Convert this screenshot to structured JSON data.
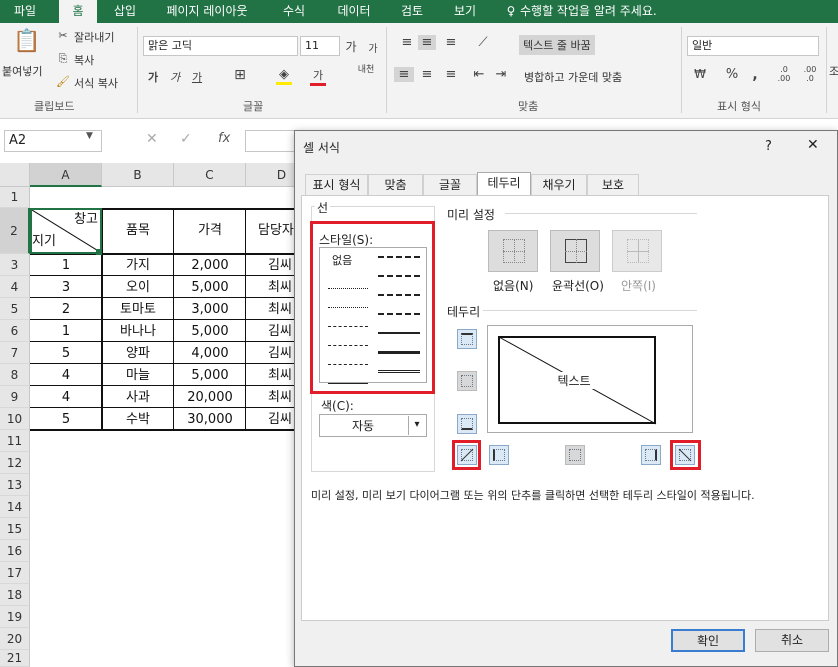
{
  "menubar": {
    "tabs": [
      "파일",
      "홈",
      "삽입",
      "페이지 레이아웃",
      "수식",
      "데이터",
      "검토",
      "보기"
    ],
    "tell_me": "수행할 작업을 알려 주세요."
  },
  "ribbon": {
    "clipboard": {
      "paste": "붙여넣기",
      "cut": "잘라내기",
      "copy": "복사",
      "format_painter": "서식 복사",
      "group": "클립보드"
    },
    "font": {
      "font_name": "맑은 고딕",
      "font_size": "11",
      "group": "글꼴",
      "grow": "가",
      "shrink": "가",
      "bold": "가",
      "italic": "가",
      "underline": "가",
      "font_color": "가",
      "phonetic": "내천"
    },
    "alignment": {
      "wrap": "텍스트 줄 바꿈",
      "merge": "병합하고 가운데 맞춤",
      "group": "맞춤"
    },
    "number": {
      "format": "일반",
      "group": "표시 형식",
      "percent": "%",
      "comma": ","
    },
    "extra": "조"
  },
  "formula_bar": {
    "name_box": "A2",
    "fx": "fx"
  },
  "sheet": {
    "columns": [
      "A",
      "B",
      "C",
      "D"
    ],
    "rows": [
      "1",
      "2",
      "3",
      "4",
      "5",
      "6",
      "7",
      "8",
      "9",
      "10",
      "11",
      "12",
      "13",
      "14",
      "15",
      "16",
      "17",
      "18",
      "19",
      "20",
      "21"
    ],
    "header": {
      "diag_top": "창고",
      "diag_bottom": "지기",
      "b": "품목",
      "c": "가격",
      "d": "담당자"
    },
    "data": [
      [
        "1",
        "가지",
        "2,000",
        "김씨"
      ],
      [
        "3",
        "오이",
        "5,000",
        "최씨"
      ],
      [
        "2",
        "토마토",
        "3,000",
        "최씨"
      ],
      [
        "1",
        "바나나",
        "5,000",
        "김씨"
      ],
      [
        "5",
        "양파",
        "4,000",
        "김씨"
      ],
      [
        "4",
        "마늘",
        "5,000",
        "최씨"
      ],
      [
        "4",
        "사과",
        "20,000",
        "최씨"
      ],
      [
        "5",
        "수박",
        "30,000",
        "김씨"
      ]
    ]
  },
  "dialog": {
    "title": "셀 서식",
    "help": "?",
    "close": "✕",
    "tabs": [
      "표시 형식",
      "맞춤",
      "글꼴",
      "테두리",
      "채우기",
      "보호"
    ],
    "line_section": "선",
    "style_label": "스타일(S):",
    "none_style": "없음",
    "color_label": "색(C):",
    "color_value": "자동",
    "presets_label": "미리 설정",
    "presets": [
      "없음(N)",
      "윤곽선(O)",
      "안쪽(I)"
    ],
    "border_label": "테두리",
    "preview_text": "텍스트",
    "description": "미리 설정, 미리 보기 다이어그램 또는 위의 단추를 클릭하면 선택한 테두리 스타일이 적용됩니다.",
    "ok": "확인",
    "cancel": "취소"
  },
  "colors": {
    "excel_green": "#217346",
    "highlight_red": "#e11d2a"
  }
}
